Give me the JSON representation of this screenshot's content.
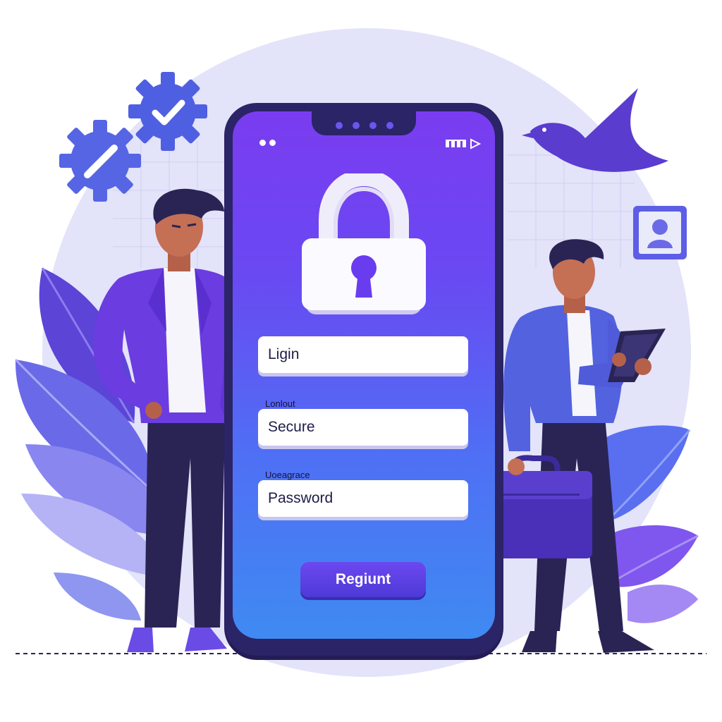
{
  "colors": {
    "accent": "#6a3cf0",
    "phone_frame": "#2b2466",
    "screen_top": "#7a3cf0",
    "screen_bottom": "#3f8af2",
    "field_bg": "#ffffff",
    "text_dark": "#1f1c4a",
    "button": "#5a42e0"
  },
  "icons": {
    "gear_check": "gear-check-icon",
    "gear_slash": "gear-slash-icon",
    "lock": "padlock-icon",
    "user": "user-icon",
    "signal": "signal-icon",
    "play": "play-icon"
  },
  "form": {
    "login_field": "Ligin",
    "caption_1": "Lonlout",
    "secure_field": "Secure",
    "caption_2": "Uoeagrace",
    "password_field": "Password",
    "submit_label": "Regiunt"
  }
}
